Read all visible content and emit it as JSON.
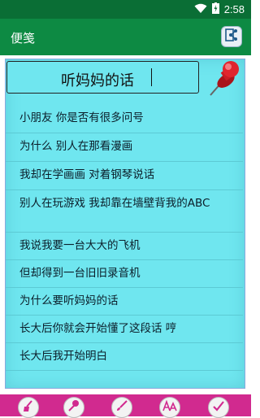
{
  "status_bar": {
    "time": "2:58"
  },
  "app_bar": {
    "title": "便笺"
  },
  "note": {
    "title": "听妈妈的话",
    "lines": [
      "小朋友 你是否有很多问号",
      "为什么 别人在那看漫画",
      "我却在学画画 对着钢琴说话",
      "别人在玩游戏 我却靠在墙壁背我的ABC",
      "我说我要一台大大的飞机",
      "但却得到一台旧旧录音机",
      "为什么要听妈妈的话",
      "长大后你就会开始懂了这段话 哼",
      "长大后我开始明白"
    ]
  },
  "toolbar": {
    "icons": [
      "clean-icon",
      "pin-icon",
      "brush-icon",
      "font-icon",
      "check-icon"
    ]
  },
  "colors": {
    "status_bar": "#0a6e35",
    "app_bar": "#0d8a43",
    "note_background": "#6fe6ef",
    "bottom_bar": "#d12a8f",
    "pin": "#d8222a"
  }
}
